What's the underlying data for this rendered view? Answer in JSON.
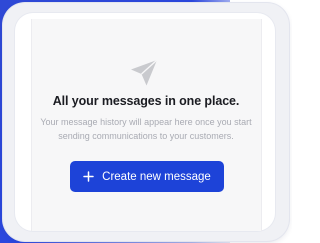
{
  "empty_state": {
    "icon": "send-icon",
    "title": "All your messages in one place.",
    "description_line1": "Your message history will appear here once you start",
    "description_line2": "sending communications to your customers."
  },
  "create_button": {
    "icon": "plus-icon",
    "label": "Create new message"
  },
  "colors": {
    "accent": "#1d43d8",
    "frame_blue": "#2a47df",
    "title_text": "#1b1c22",
    "muted_text": "#a9abb3",
    "icon_grey": "#c9cace"
  }
}
